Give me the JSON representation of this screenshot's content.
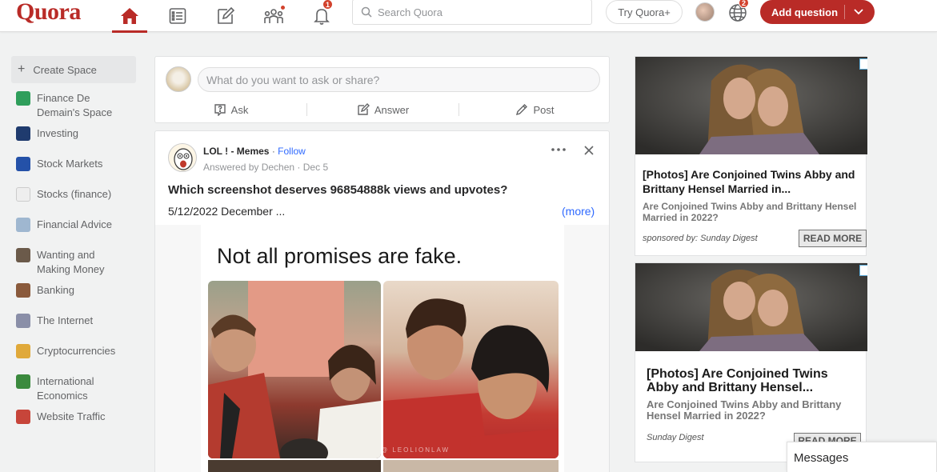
{
  "header": {
    "logo": "Quora",
    "notification_count": "1",
    "language_count": "2",
    "search_placeholder": "Search Quora",
    "try_plus": "Try Quora+",
    "add_question": "Add question"
  },
  "sidebar": {
    "create_space": "Create Space",
    "items": [
      {
        "label": "Finance De Demain's Space",
        "icon_color": "#2f9e5b"
      },
      {
        "label": "Investing",
        "icon_color": "#1f3b6e"
      },
      {
        "label": "Stock Markets",
        "icon_color": "#2451a8"
      },
      {
        "label": "Stocks (finance)",
        "icon_color": "#eeeeee"
      },
      {
        "label": "Financial Advice",
        "icon_color": "#9fb7d0"
      },
      {
        "label": "Wanting and Making Money",
        "icon_color": "#6b5a4a"
      },
      {
        "label": "Banking",
        "icon_color": "#8a5a3c"
      },
      {
        "label": "The Internet",
        "icon_color": "#8a8fa8"
      },
      {
        "label": "Cryptocurrencies",
        "icon_color": "#e0a93a"
      },
      {
        "label": "International Economics",
        "icon_color": "#3b8a3e"
      },
      {
        "label": "Website Traffic",
        "icon_color": "#c7453a"
      }
    ]
  },
  "ask_box": {
    "placeholder": "What do you want to ask or share?",
    "actions": [
      "Ask",
      "Answer",
      "Post"
    ]
  },
  "post": {
    "source_name": "LOL ! - Memes",
    "follow": "Follow",
    "answered_by": "Answered by Dechen",
    "date": "Dec 5",
    "title": "Which screenshot deserves 96854888k views and upvotes?",
    "excerpt": "5/12/2022 December ...",
    "more": "(more)",
    "image_caption": "Not all promises are fake.",
    "watermark": "@ LEOLIONLAW"
  },
  "ads": [
    {
      "title": "[Photos] Are Conjoined Twins Abby and Brittany Hensel Married in...",
      "subtitle": "Are Conjoined Twins Abby and Brittany Hensel Married in 2022?",
      "source": "sponsored by: Sunday Digest",
      "button": "READ MORE"
    },
    {
      "title": "[Photos] Are Conjoined Twins Abby and Brittany Hensel...",
      "subtitle": "Are Conjoined Twins Abby and Brittany Hensel Married in 2022?",
      "source": "Sunday Digest",
      "button": "READ MORE"
    }
  ],
  "messages": "Messages",
  "colors": {
    "brand": "#b92b27",
    "link": "#2e69ff",
    "badge": "#d2422d"
  }
}
